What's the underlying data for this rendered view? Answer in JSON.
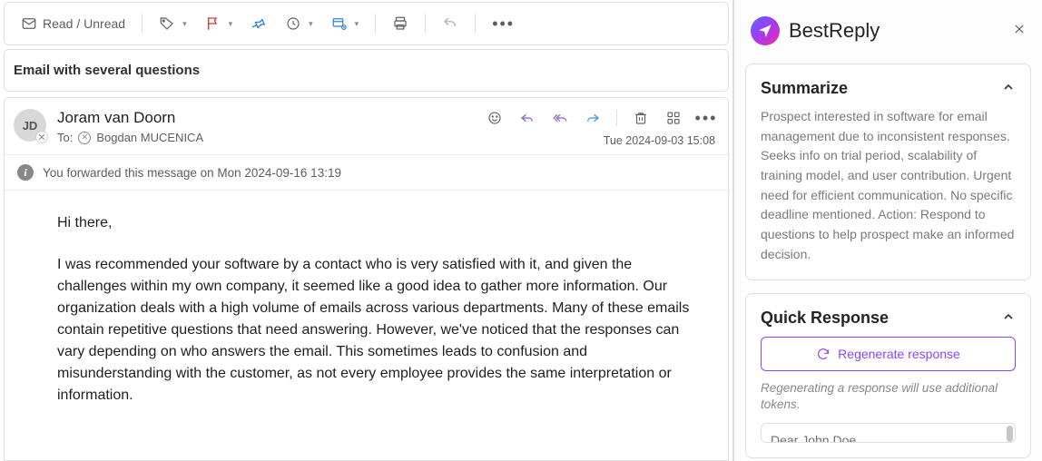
{
  "toolbar": {
    "read_unread_label": "Read / Unread"
  },
  "subject": "Email with several questions",
  "message": {
    "avatar_initials": "JD",
    "from_name": "Joram van Doorn",
    "to_label": "To:",
    "to_name": "Bogdan MUCENICA",
    "date": "Tue 2024-09-03 15:08",
    "forward_banner": "You forwarded this message on Mon 2024-09-16 13:19",
    "body_greeting": "Hi there,",
    "body_p1": "I was recommended your software by a contact who is very satisfied with it, and given the challenges within my own company, it seemed like a good idea to gather more information. Our organization deals with a high volume of emails across various departments. Many of these emails contain repetitive questions that need answering. However, we've noticed that the responses can vary depending on who answers the email. This sometimes leads to confusion and misunderstanding with the customer, as not every employee provides the same interpretation or information."
  },
  "panel": {
    "brand": "BestReply",
    "summarize": {
      "title": "Summarize",
      "text": "Prospect interested in software for email management due to inconsistent responses. Seeks info on trial period, scalability of training model, and user contribution. Urgent need for efficient communication. No specific deadline mentioned. Action: Respond to questions to help prospect make an informed decision."
    },
    "quick": {
      "title": "Quick Response",
      "regen_label": "Regenerate response",
      "note": "Regenerating a response will use additional tokens.",
      "draft_preview": "Dear John Doe"
    }
  }
}
